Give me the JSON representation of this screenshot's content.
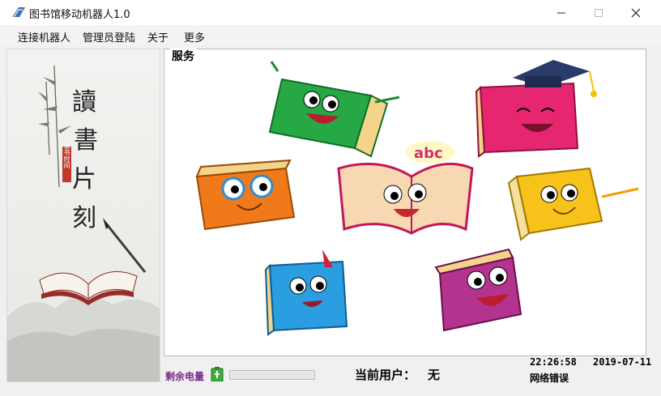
{
  "window": {
    "title": "图书馆移动机器人1.0",
    "minimize_icon": "minimize-icon",
    "maximize_icon": "maximize-icon",
    "close_icon": "close-icon"
  },
  "menu": [
    "连接机器人",
    "管理员登陆",
    "关于",
    "更多"
  ],
  "left_panel": {
    "calligraphy": [
      "讀",
      "書",
      "片",
      "刻"
    ],
    "seal_text": "读书时间"
  },
  "service_group": {
    "title": "服务",
    "illustration_text": "abc"
  },
  "status": {
    "battery_label": "剩余电量",
    "battery_icon": "battery-icon",
    "battery_level": 0,
    "current_user_label": "当前用户：",
    "current_user_value": "无",
    "time": "22:26:58",
    "date": "2019-07-11",
    "network_status": "网络错误"
  },
  "colors": {
    "battery_label": "#7a2b8f",
    "progress_fill": "#06b025"
  }
}
